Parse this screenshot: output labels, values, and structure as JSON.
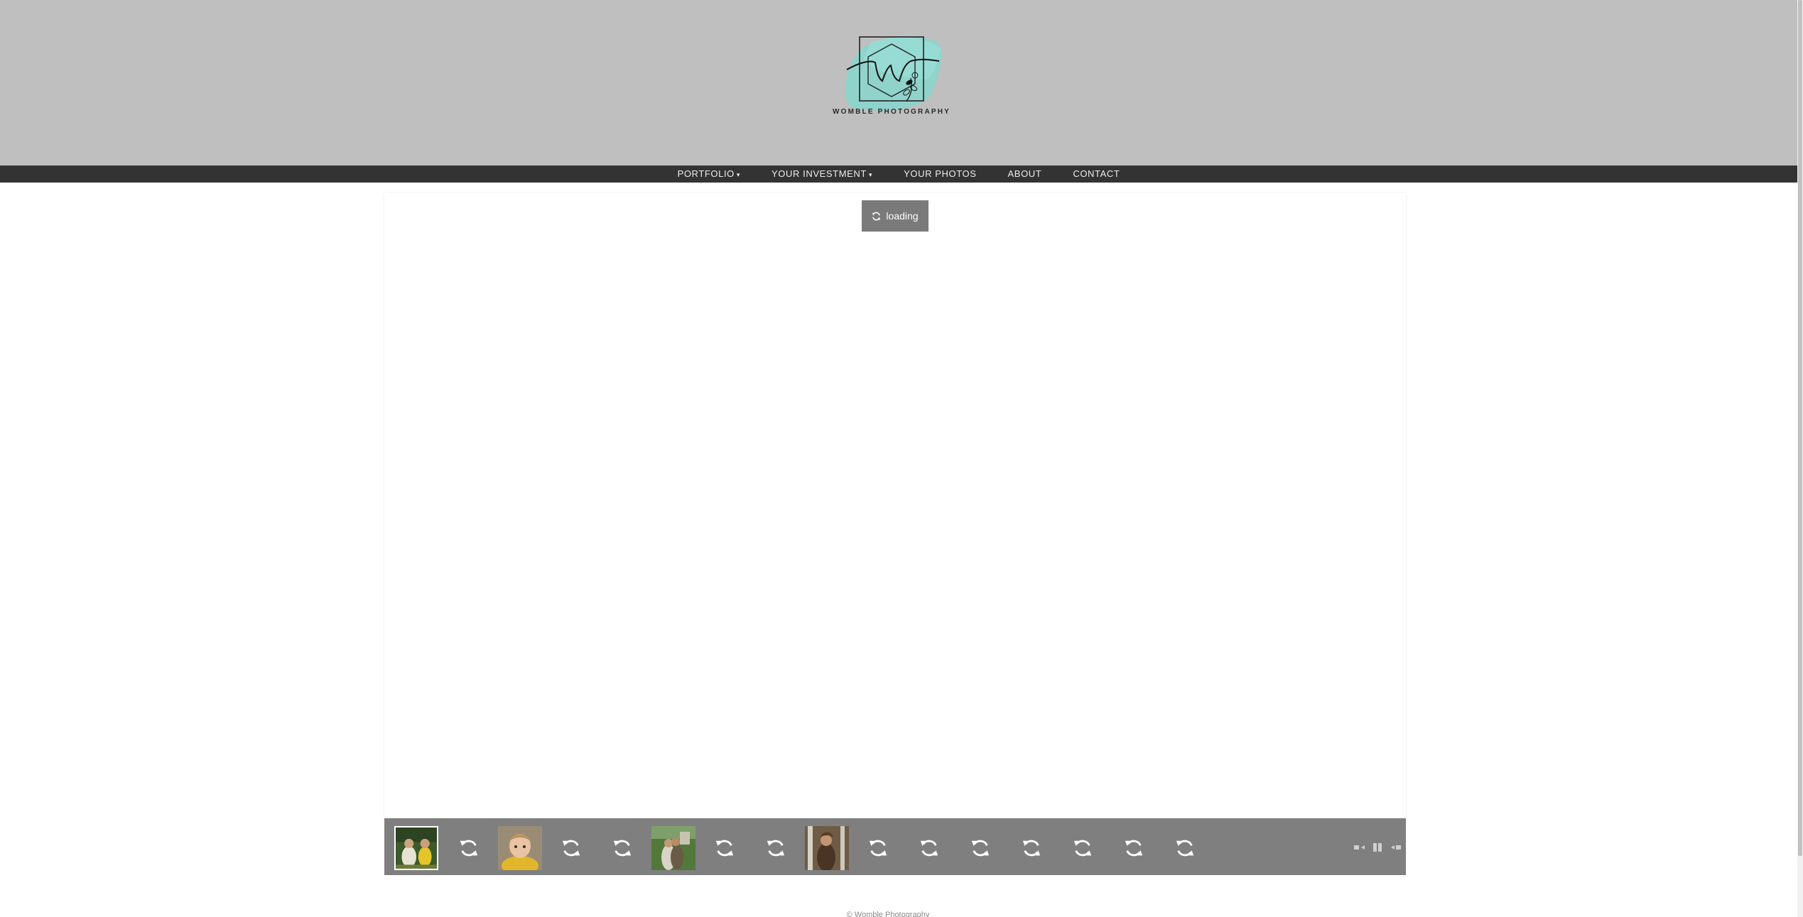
{
  "brand": {
    "name": "WOMBLE PHOTOGRAPHY",
    "monogram": "W",
    "accent_color": "#7fd9cf"
  },
  "nav": {
    "items": [
      {
        "label": "PORTFOLIO",
        "caret": "▾"
      },
      {
        "label": "YOUR INVESTMENT",
        "caret": "▾"
      },
      {
        "label": "YOUR PHOTOS",
        "caret": ""
      },
      {
        "label": "ABOUT",
        "caret": ""
      },
      {
        "label": "CONTACT",
        "caret": ""
      }
    ]
  },
  "gallery": {
    "loading_label": "loading",
    "loading_icon": "refresh-icon",
    "thumbnails": [
      {
        "kind": "photo",
        "active": true
      },
      {
        "kind": "loading"
      },
      {
        "kind": "photo"
      },
      {
        "kind": "loading"
      },
      {
        "kind": "loading"
      },
      {
        "kind": "photo"
      },
      {
        "kind": "loading"
      },
      {
        "kind": "loading"
      },
      {
        "kind": "photo"
      },
      {
        "kind": "loading"
      },
      {
        "kind": "loading"
      },
      {
        "kind": "loading"
      },
      {
        "kind": "loading"
      },
      {
        "kind": "loading"
      },
      {
        "kind": "loading"
      },
      {
        "kind": "loading"
      }
    ],
    "controls": [
      "prev-icon",
      "pause-icon",
      "next-icon"
    ]
  },
  "footer": {
    "text": "© Womble Photography"
  }
}
